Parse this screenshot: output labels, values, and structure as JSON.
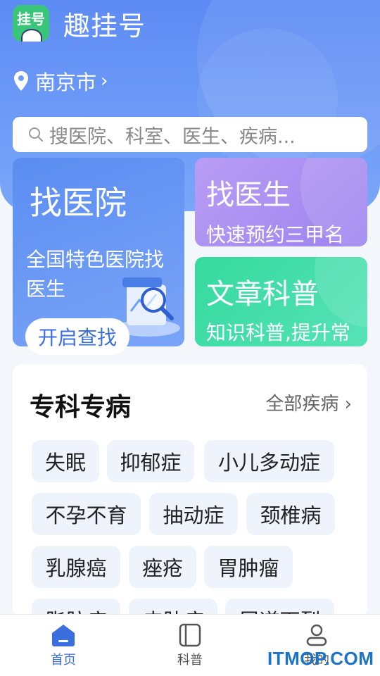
{
  "app": {
    "logo_text": "挂号",
    "title": "趣挂号"
  },
  "location": {
    "city": "南京市",
    "chevron": "›"
  },
  "search": {
    "placeholder": "搜医院、科室、医生、疾病..."
  },
  "cards": {
    "hospital": {
      "title": "找医院",
      "desc": "全国特色医院找医生",
      "cta": "开启查找"
    },
    "doctor": {
      "title": "找医生",
      "desc": "快速预约三甲名"
    },
    "article": {
      "title": "文章科普",
      "desc": "知识科普,提升常识"
    }
  },
  "specialty": {
    "title": "专科专病",
    "more": "全部疾病",
    "tags": [
      "失眠",
      "抑郁症",
      "小儿多动症",
      "不孕不育",
      "抽动症",
      "颈椎病",
      "乳腺癌",
      "痤疮",
      "胃肿瘤",
      "脂肪病",
      "皮肤病",
      "尿道下裂"
    ]
  },
  "tabbar": {
    "home": "首页",
    "science": "科普",
    "mine": "我的"
  },
  "watermark": "ITMOP.COM",
  "colors": {
    "primary": "#3b6fe0",
    "hero": "#6f9cf7",
    "doctor_card": "#a88ef0",
    "article_card": "#3ddca6",
    "logo": "#39c67a"
  }
}
